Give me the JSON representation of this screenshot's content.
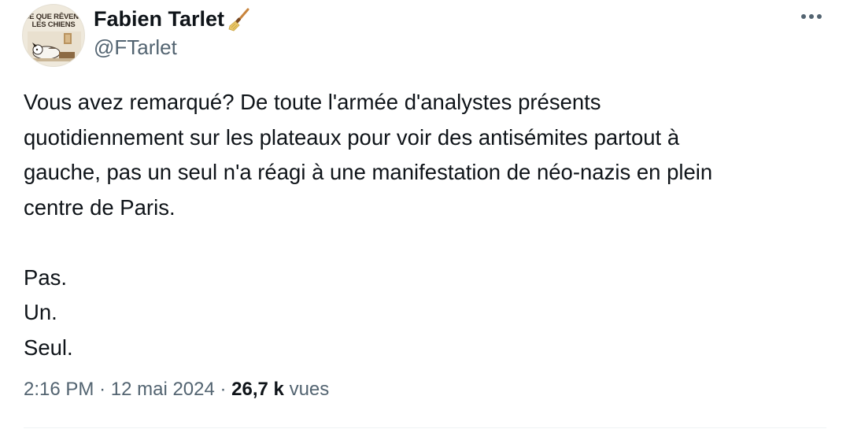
{
  "author": {
    "display_name": "Fabien Tarlet",
    "handle": "@FTarlet",
    "badge_icon": "broom-icon",
    "avatar": {
      "book_title_line1": "CE QUE RÊVENT",
      "book_title_line2": "LES CHIENS"
    }
  },
  "menu_icon": "more-horizontal-icon",
  "tweet": {
    "lines": [
      "Vous avez remarqué? De toute l'armée d'analystes présents",
      "quotidiennement sur les plateaux pour voir des antisémites partout à",
      "gauche, pas un seul n'a réagi à une manifestation de néo-nazis en plein",
      "centre de Paris.",
      "",
      "Pas.",
      "Un.",
      "Seul."
    ]
  },
  "meta": {
    "time": "2:16 PM",
    "separator": "·",
    "date": "12 mai 2024",
    "views_count": "26,7 k",
    "views_label": "vues"
  },
  "colors": {
    "text_primary": "#0f1419",
    "text_secondary": "#536471",
    "divider": "#eff3f4"
  }
}
